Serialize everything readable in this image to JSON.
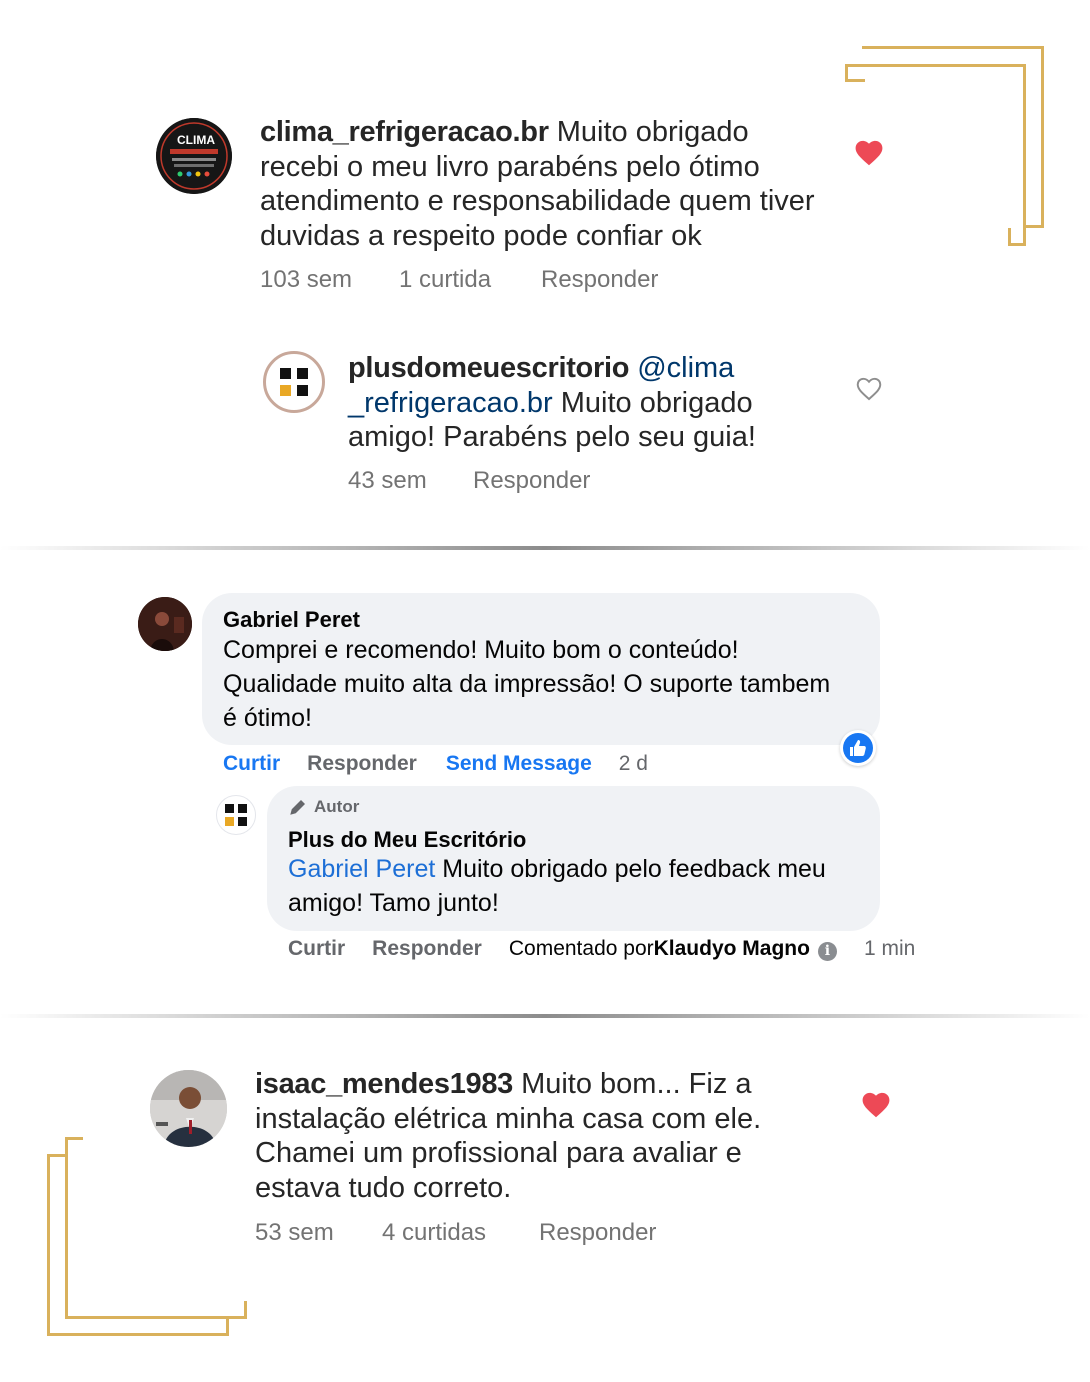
{
  "ig_comment_1": {
    "username": "clima_refrigeracao.br",
    "lines_after_username": " Muito obrigado",
    "text_lines": [
      "recebi o meu livro parabéns pelo ótimo",
      "atendimento e responsabilidade  quem tiver",
      "duvidas a respeito pode confiar ok"
    ],
    "time": "103 sem",
    "likes": "1 curtida",
    "reply": "Responder",
    "avatar_text": "CLIMA"
  },
  "ig_reply_1": {
    "username": "plusdomeuescritorio",
    "mention_part1": "@clima",
    "mention_part2": "_refrigeracao.br",
    "text_after_mention": " Muito obrigado",
    "text_lines": [
      "amigo! Parabéns pelo seu guia!"
    ],
    "time": "43 sem",
    "reply": "Responder"
  },
  "fb_comment": {
    "name": "Gabriel Peret",
    "text_lines": [
      "Comprei e recomendo! Muito bom o conteúdo!",
      "Qualidade muito alta da impressão! O suporte tambem",
      "é ótimo!"
    ],
    "like": "Curtir",
    "reply": "Responder",
    "send_message": "Send Message",
    "time": "2 d"
  },
  "fb_reply": {
    "badge": "Autor",
    "name": "Plus do Meu Escritório",
    "mention": "Gabriel Peret",
    "text_after_mention": " Muito obrigado pelo feedback meu",
    "text_lines": [
      "amigo! Tamo junto!"
    ],
    "like": "Curtir",
    "reply": "Responder",
    "commented_by_label": "Comentado por ",
    "commented_by_name": "Klaudyo Magno",
    "time": "1 min"
  },
  "ig_comment_2": {
    "username": "isaac_mendes1983",
    "text_after_username": " Muito bom... Fiz a",
    "text_lines": [
      "instalação elétrica minha casa com ele.",
      "Chamei um profissional para avaliar e",
      "estava tudo correto."
    ],
    "time": "53 sem",
    "likes": "4 curtidas",
    "reply": "Responder"
  },
  "colors": {
    "gold": "#d9b15c",
    "heart_red": "#ed4956",
    "fb_blue": "#1877f2",
    "mention_blue": "#00376b"
  }
}
